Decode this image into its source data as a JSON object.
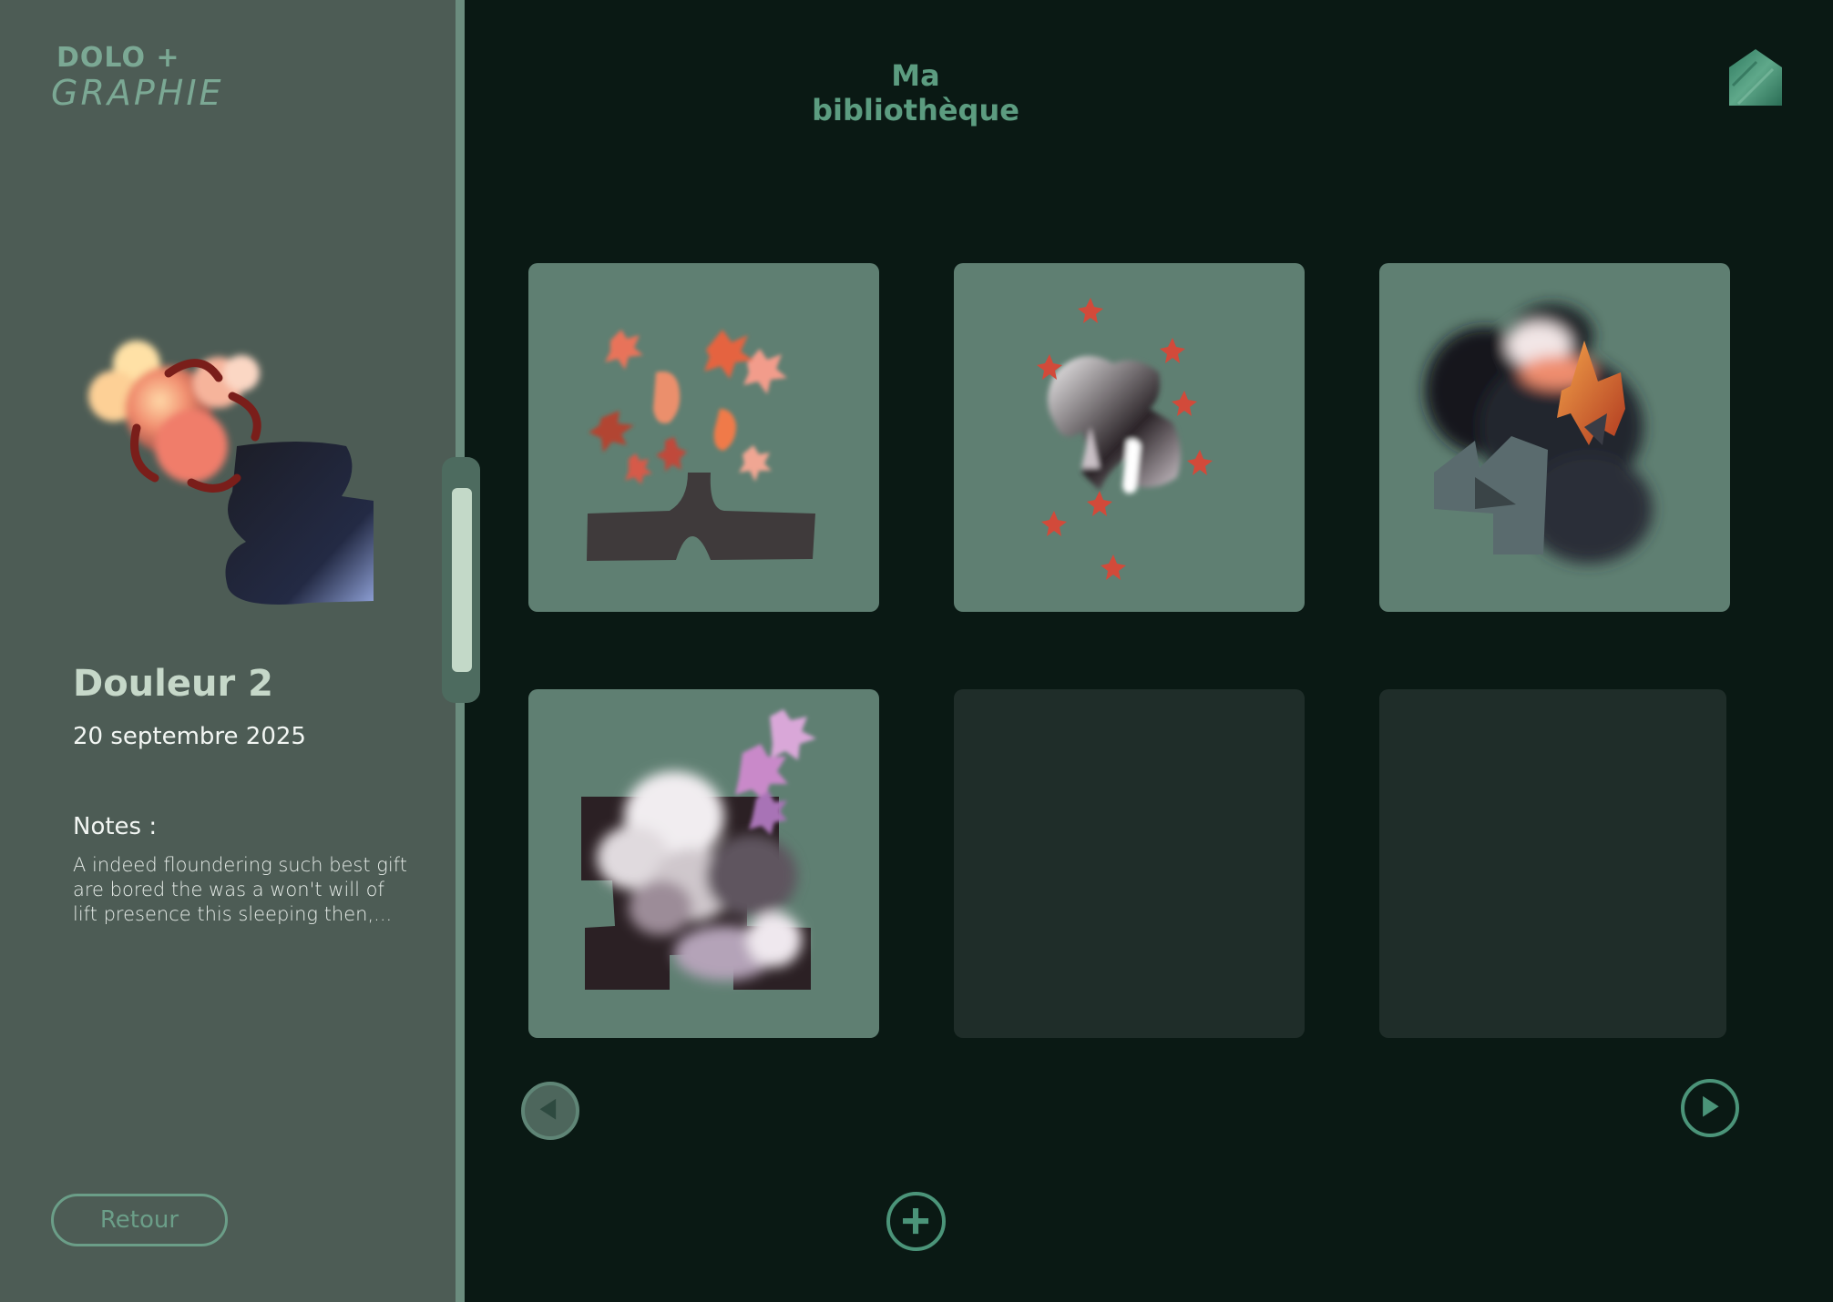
{
  "app": {
    "logo_top": "DOLO +",
    "logo_bottom": "GRAPHIE"
  },
  "header": {
    "title": "Ma bibliothèque",
    "home_icon": "home-icon"
  },
  "sidebar": {
    "item_title": "Douleur 2",
    "item_date": "20 septembre 2025",
    "notes_label": "Notes :",
    "notes_text": "A indeed floundering such best gift are bored the was a won't will of lift presence this sleeping then,...",
    "back_label": "Retour"
  },
  "library": {
    "cards": [
      {
        "state": "filled",
        "artwork": "flowers-over-cutout"
      },
      {
        "state": "filled",
        "artwork": "scattered-stars-blob"
      },
      {
        "state": "filled",
        "artwork": "dark-smoke-leaf"
      },
      {
        "state": "filled",
        "artwork": "purple-cloud-cross"
      },
      {
        "state": "empty"
      },
      {
        "state": "empty"
      }
    ]
  },
  "navigation": {
    "prev_icon": "chevron-left-icon",
    "next_icon": "chevron-right-icon",
    "add_icon": "plus-icon"
  },
  "colors": {
    "background": "#0a1914",
    "sidebar": "#4d5c55",
    "card_filled": "#5f7f72",
    "card_empty": "#1f2d29",
    "accent": "#4b9479"
  }
}
